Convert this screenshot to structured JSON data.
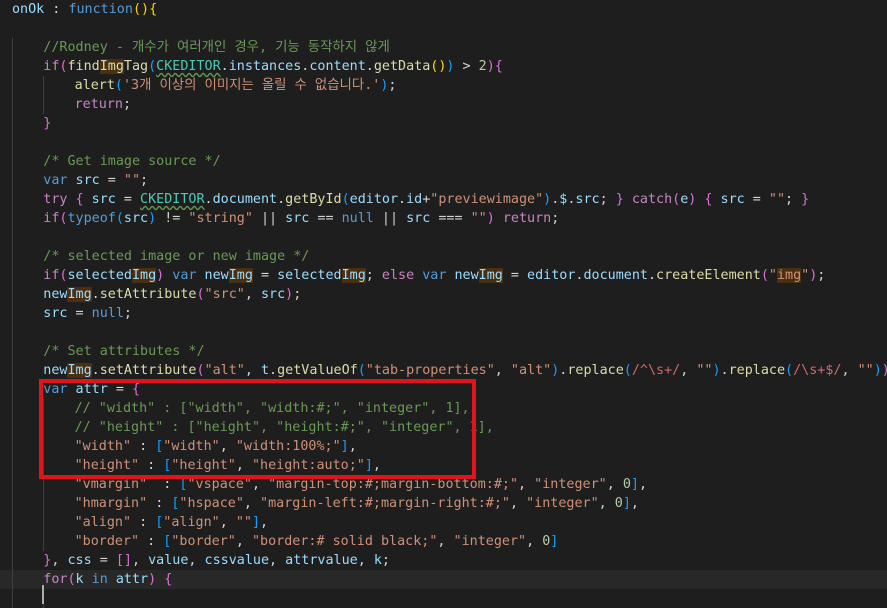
{
  "editor": {
    "language": "javascript",
    "theme_colors": {
      "background": "#1e1e1e",
      "keyword": "#569cd6",
      "control": "#c586c0",
      "string": "#ce9178",
      "number": "#b5cea8",
      "comment": "#6a9955",
      "identifier": "#9cdcfe",
      "function": "#dcdcaa",
      "highlight_box": "#e0141b"
    },
    "lines": [
      {
        "indent": 0,
        "tokens": [
          [
            "t-ident",
            "onOk"
          ],
          [
            "t-p",
            " : "
          ],
          [
            "t-kw",
            "function"
          ],
          [
            "t-br1",
            "()"
          ],
          [
            "t-br1",
            "{"
          ]
        ]
      },
      {
        "indent": 0,
        "tokens": []
      },
      {
        "indent": 1,
        "tokens": [
          [
            "t-cmt",
            "//Rodney - 개수가 여러개인 경우, 기능 동작하지 않게"
          ]
        ]
      },
      {
        "indent": 1,
        "tokens": [
          [
            "t-ctrl",
            "if"
          ],
          [
            "t-br2",
            "("
          ],
          [
            "t-fn",
            "find"
          ],
          [
            "t-fn hl",
            "Img"
          ],
          [
            "t-fn",
            "Tag"
          ],
          [
            "t-br3",
            "("
          ],
          [
            "t-cls squiggle",
            "CKEDITOR"
          ],
          [
            "t-p",
            "."
          ],
          [
            "t-ident",
            "instances"
          ],
          [
            "t-p",
            "."
          ],
          [
            "t-ident",
            "content"
          ],
          [
            "t-p",
            "."
          ],
          [
            "t-fn",
            "getData"
          ],
          [
            "t-br1",
            "()"
          ],
          [
            "t-br3",
            ")"
          ],
          [
            "t-p",
            " > "
          ],
          [
            "t-num",
            "2"
          ],
          [
            "t-br2",
            ")"
          ],
          [
            "t-br2",
            "{"
          ]
        ]
      },
      {
        "indent": 2,
        "tokens": [
          [
            "t-fn",
            "alert"
          ],
          [
            "t-br3",
            "("
          ],
          [
            "t-str",
            "'3개 이상의 이미지는 올릴 수 없습니다.'"
          ],
          [
            "t-br3",
            ")"
          ],
          [
            "t-p",
            ";"
          ]
        ]
      },
      {
        "indent": 2,
        "tokens": [
          [
            "t-ctrl",
            "return"
          ],
          [
            "t-p",
            ";"
          ]
        ]
      },
      {
        "indent": 1,
        "tokens": [
          [
            "t-br2",
            "}"
          ]
        ]
      },
      {
        "indent": 1,
        "tokens": []
      },
      {
        "indent": 1,
        "tokens": [
          [
            "t-cmt",
            "/* Get image source */"
          ]
        ]
      },
      {
        "indent": 1,
        "tokens": [
          [
            "t-kw",
            "var"
          ],
          [
            "t-p",
            " "
          ],
          [
            "t-ident",
            "src"
          ],
          [
            "t-p",
            " = "
          ],
          [
            "t-str",
            "\"\""
          ],
          [
            "t-p",
            ";"
          ]
        ]
      },
      {
        "indent": 1,
        "tokens": [
          [
            "t-ctrl",
            "try"
          ],
          [
            "t-p",
            " "
          ],
          [
            "t-br2",
            "{"
          ],
          [
            "t-p",
            " "
          ],
          [
            "t-ident",
            "src"
          ],
          [
            "t-p",
            " = "
          ],
          [
            "t-cls squiggle",
            "CKEDITOR"
          ],
          [
            "t-p",
            "."
          ],
          [
            "t-ident",
            "document"
          ],
          [
            "t-p",
            "."
          ],
          [
            "t-fn",
            "getById"
          ],
          [
            "t-br3",
            "("
          ],
          [
            "t-ident",
            "editor"
          ],
          [
            "t-p",
            "."
          ],
          [
            "t-ident",
            "id"
          ],
          [
            "t-p",
            "+"
          ],
          [
            "t-str",
            "\"previewimage\""
          ],
          [
            "t-br3",
            ")"
          ],
          [
            "t-p",
            "."
          ],
          [
            "t-ident",
            "$"
          ],
          [
            "t-p",
            "."
          ],
          [
            "t-ident",
            "src"
          ],
          [
            "t-p",
            "; "
          ],
          [
            "t-br2",
            "}"
          ],
          [
            "t-p",
            " "
          ],
          [
            "t-ctrl",
            "catch"
          ],
          [
            "t-br2",
            "("
          ],
          [
            "t-ident",
            "e"
          ],
          [
            "t-br2",
            ")"
          ],
          [
            "t-p",
            " "
          ],
          [
            "t-br2",
            "{"
          ],
          [
            "t-p",
            " "
          ],
          [
            "t-ident",
            "src"
          ],
          [
            "t-p",
            " = "
          ],
          [
            "t-str",
            "\"\""
          ],
          [
            "t-p",
            "; "
          ],
          [
            "t-br2",
            "}"
          ]
        ]
      },
      {
        "indent": 1,
        "tokens": [
          [
            "t-ctrl",
            "if"
          ],
          [
            "t-br2",
            "("
          ],
          [
            "t-kw",
            "typeof"
          ],
          [
            "t-br3",
            "("
          ],
          [
            "t-ident",
            "src"
          ],
          [
            "t-br3",
            ")"
          ],
          [
            "t-p",
            " != "
          ],
          [
            "t-str",
            "\"string\""
          ],
          [
            "t-p",
            " || "
          ],
          [
            "t-ident",
            "src"
          ],
          [
            "t-p",
            " == "
          ],
          [
            "t-kw",
            "null"
          ],
          [
            "t-p",
            " || "
          ],
          [
            "t-ident",
            "src"
          ],
          [
            "t-p",
            " === "
          ],
          [
            "t-str",
            "\"\""
          ],
          [
            "t-br2",
            ")"
          ],
          [
            "t-p",
            " "
          ],
          [
            "t-ctrl",
            "return"
          ],
          [
            "t-p",
            ";"
          ]
        ]
      },
      {
        "indent": 1,
        "tokens": []
      },
      {
        "indent": 1,
        "tokens": [
          [
            "t-cmt",
            "/* selected image or new image */"
          ]
        ]
      },
      {
        "indent": 1,
        "tokens": [
          [
            "t-ctrl",
            "if"
          ],
          [
            "t-br2",
            "("
          ],
          [
            "t-ident",
            "selected"
          ],
          [
            "t-ident hl",
            "Img"
          ],
          [
            "t-br2",
            ")"
          ],
          [
            "t-p",
            " "
          ],
          [
            "t-kw",
            "var"
          ],
          [
            "t-p",
            " "
          ],
          [
            "t-ident",
            "new"
          ],
          [
            "t-ident hl",
            "Img"
          ],
          [
            "t-p",
            " = "
          ],
          [
            "t-ident",
            "selected"
          ],
          [
            "t-ident hl",
            "Img"
          ],
          [
            "t-p",
            "; "
          ],
          [
            "t-ctrl",
            "else"
          ],
          [
            "t-p",
            " "
          ],
          [
            "t-kw",
            "var"
          ],
          [
            "t-p",
            " "
          ],
          [
            "t-ident",
            "new"
          ],
          [
            "t-ident hl",
            "Img"
          ],
          [
            "t-p",
            " = "
          ],
          [
            "t-ident",
            "editor"
          ],
          [
            "t-p",
            "."
          ],
          [
            "t-ident",
            "document"
          ],
          [
            "t-p",
            "."
          ],
          [
            "t-fn",
            "createElement"
          ],
          [
            "t-br2",
            "("
          ],
          [
            "t-str",
            "\""
          ],
          [
            "t-str hl",
            "img"
          ],
          [
            "t-str",
            "\""
          ],
          [
            "t-br2",
            ")"
          ],
          [
            "t-p",
            ";"
          ]
        ]
      },
      {
        "indent": 1,
        "tokens": [
          [
            "t-ident",
            "new"
          ],
          [
            "t-ident hl",
            "Img"
          ],
          [
            "t-p",
            "."
          ],
          [
            "t-fn",
            "setAttribute"
          ],
          [
            "t-br2",
            "("
          ],
          [
            "t-str",
            "\"src\""
          ],
          [
            "t-p",
            ", "
          ],
          [
            "t-ident",
            "src"
          ],
          [
            "t-br2",
            ")"
          ],
          [
            "t-p",
            ";"
          ]
        ]
      },
      {
        "indent": 1,
        "tokens": [
          [
            "t-ident",
            "src"
          ],
          [
            "t-p",
            " = "
          ],
          [
            "t-kw",
            "null"
          ],
          [
            "t-p",
            ";"
          ]
        ]
      },
      {
        "indent": 1,
        "tokens": []
      },
      {
        "indent": 1,
        "tokens": [
          [
            "t-cmt",
            "/* Set attributes */"
          ]
        ]
      },
      {
        "indent": 1,
        "tokens": [
          [
            "t-ident",
            "new"
          ],
          [
            "t-ident hl",
            "Img"
          ],
          [
            "t-p",
            "."
          ],
          [
            "t-fn",
            "setAttribute"
          ],
          [
            "t-br2",
            "("
          ],
          [
            "t-str",
            "\"alt\""
          ],
          [
            "t-p",
            ", "
          ],
          [
            "t-ident",
            "t"
          ],
          [
            "t-p",
            "."
          ],
          [
            "t-fn",
            "getValueOf"
          ],
          [
            "t-br3",
            "("
          ],
          [
            "t-str",
            "\"tab-properties\""
          ],
          [
            "t-p",
            ", "
          ],
          [
            "t-str",
            "\"alt\""
          ],
          [
            "t-br3",
            ")"
          ],
          [
            "t-p",
            "."
          ],
          [
            "t-fn",
            "replace"
          ],
          [
            "t-br3",
            "("
          ],
          [
            "t-re",
            "/^\\s+/"
          ],
          [
            "t-p",
            ", "
          ],
          [
            "t-str",
            "\"\""
          ],
          [
            "t-br3",
            ")"
          ],
          [
            "t-p",
            "."
          ],
          [
            "t-fn",
            "replace"
          ],
          [
            "t-br3",
            "("
          ],
          [
            "t-re",
            "/\\s+$/"
          ],
          [
            "t-p",
            ", "
          ],
          [
            "t-str",
            "\"\""
          ],
          [
            "t-br3",
            ")"
          ],
          [
            "t-br2",
            ")"
          ],
          [
            "t-p",
            ";"
          ]
        ]
      },
      {
        "indent": 1,
        "tokens": [
          [
            "t-kw",
            "var"
          ],
          [
            "t-p",
            " "
          ],
          [
            "t-ident",
            "attr"
          ],
          [
            "t-p",
            " = "
          ],
          [
            "t-br2",
            "{"
          ]
        ]
      },
      {
        "indent": 2,
        "tokens": [
          [
            "t-cmt",
            "// \"width\" : [\"width\", \"width:#;\", \"integer\", 1],"
          ]
        ]
      },
      {
        "indent": 2,
        "tokens": [
          [
            "t-cmt",
            "// \"height\" : [\"height\", \"height:#;\", \"integer\", 1],"
          ]
        ]
      },
      {
        "indent": 2,
        "tokens": [
          [
            "t-str",
            "\"width\""
          ],
          [
            "t-p",
            " : "
          ],
          [
            "t-br3",
            "["
          ],
          [
            "t-str",
            "\"width\""
          ],
          [
            "t-p",
            ", "
          ],
          [
            "t-str",
            "\"width:100%;\""
          ],
          [
            "t-br3",
            "]"
          ],
          [
            "t-p",
            ","
          ]
        ]
      },
      {
        "indent": 2,
        "tokens": [
          [
            "t-str",
            "\"height\""
          ],
          [
            "t-p",
            " : "
          ],
          [
            "t-br3",
            "["
          ],
          [
            "t-str",
            "\"height\""
          ],
          [
            "t-p",
            ", "
          ],
          [
            "t-str",
            "\"height:auto;\""
          ],
          [
            "t-br3",
            "]"
          ],
          [
            "t-p",
            ","
          ]
        ]
      },
      {
        "indent": 2,
        "tokens": [
          [
            "t-str",
            "\"vmargin\""
          ],
          [
            "t-p",
            "  : "
          ],
          [
            "t-br3",
            "["
          ],
          [
            "t-str",
            "\"vspace\""
          ],
          [
            "t-p",
            ", "
          ],
          [
            "t-str",
            "\"margin-top:#;margin-bottom:#;\""
          ],
          [
            "t-p",
            ", "
          ],
          [
            "t-str",
            "\"integer\""
          ],
          [
            "t-p",
            ", "
          ],
          [
            "t-num",
            "0"
          ],
          [
            "t-br3",
            "]"
          ],
          [
            "t-p",
            ","
          ]
        ]
      },
      {
        "indent": 2,
        "tokens": [
          [
            "t-str",
            "\"hmargin\""
          ],
          [
            "t-p",
            " : "
          ],
          [
            "t-br3",
            "["
          ],
          [
            "t-str",
            "\"hspace\""
          ],
          [
            "t-p",
            ", "
          ],
          [
            "t-str",
            "\"margin-left:#;margin-right:#;\""
          ],
          [
            "t-p",
            ", "
          ],
          [
            "t-str",
            "\"integer\""
          ],
          [
            "t-p",
            ", "
          ],
          [
            "t-num",
            "0"
          ],
          [
            "t-br3",
            "]"
          ],
          [
            "t-p",
            ","
          ]
        ]
      },
      {
        "indent": 2,
        "tokens": [
          [
            "t-str",
            "\"align\""
          ],
          [
            "t-p",
            " : "
          ],
          [
            "t-br3",
            "["
          ],
          [
            "t-str",
            "\"align\""
          ],
          [
            "t-p",
            ", "
          ],
          [
            "t-str",
            "\"\""
          ],
          [
            "t-br3",
            "]"
          ],
          [
            "t-p",
            ","
          ]
        ]
      },
      {
        "indent": 2,
        "tokens": [
          [
            "t-str",
            "\"border\""
          ],
          [
            "t-p",
            " : "
          ],
          [
            "t-br3",
            "["
          ],
          [
            "t-str",
            "\"border\""
          ],
          [
            "t-p",
            ", "
          ],
          [
            "t-str",
            "\"border:# solid black;\""
          ],
          [
            "t-p",
            ", "
          ],
          [
            "t-str",
            "\"integer\""
          ],
          [
            "t-p",
            ", "
          ],
          [
            "t-num",
            "0"
          ],
          [
            "t-br3",
            "]"
          ]
        ]
      },
      {
        "indent": 1,
        "tokens": [
          [
            "t-br2",
            "}"
          ],
          [
            "t-p",
            ", "
          ],
          [
            "t-ident",
            "css"
          ],
          [
            "t-p",
            " = "
          ],
          [
            "t-br2",
            "[]"
          ],
          [
            "t-p",
            ", "
          ],
          [
            "t-ident",
            "value"
          ],
          [
            "t-p",
            ", "
          ],
          [
            "t-ident",
            "cssvalue"
          ],
          [
            "t-p",
            ", "
          ],
          [
            "t-ident",
            "attrvalue"
          ],
          [
            "t-p",
            ", "
          ],
          [
            "t-ident",
            "k"
          ],
          [
            "t-p",
            ";"
          ]
        ]
      },
      {
        "indent": 1,
        "tokens": [
          [
            "t-ctrl",
            "for"
          ],
          [
            "t-br2",
            "("
          ],
          [
            "t-ident",
            "k"
          ],
          [
            "t-p",
            " "
          ],
          [
            "t-kw",
            "in"
          ],
          [
            "t-p",
            " "
          ],
          [
            "t-ident",
            "attr"
          ],
          [
            "t-br2",
            ")"
          ],
          [
            "t-p",
            " "
          ],
          [
            "t-br2",
            "{"
          ]
        ]
      },
      {
        "indent": 2,
        "tokens": []
      }
    ],
    "current_line": 30
  }
}
